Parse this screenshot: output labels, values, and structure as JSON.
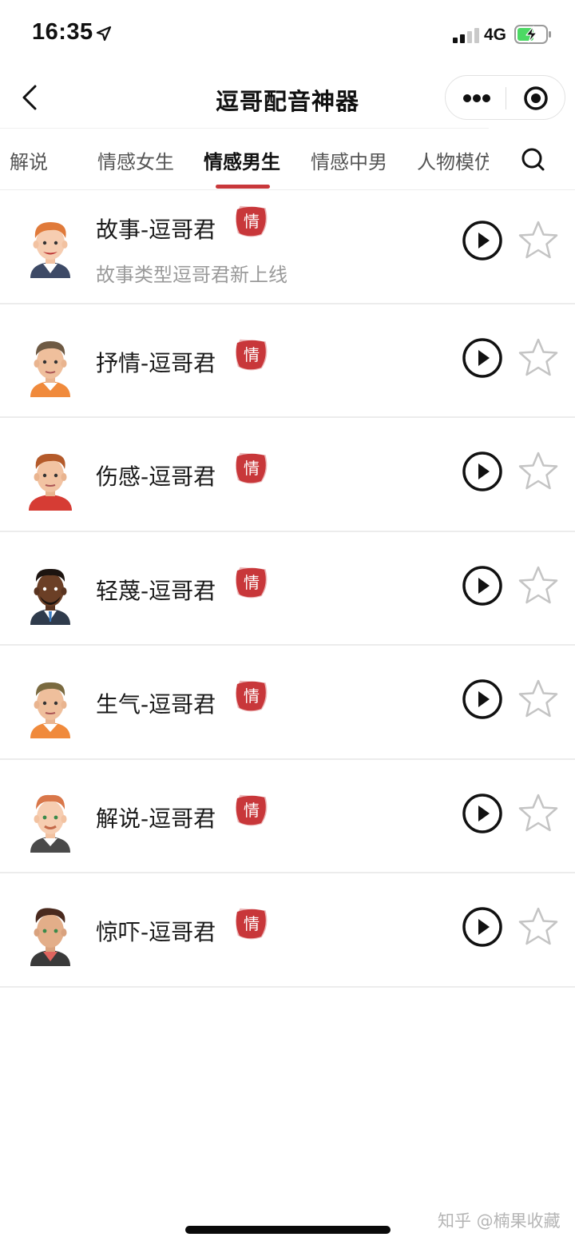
{
  "status_bar": {
    "time": "16:35",
    "network": "4G",
    "icons": [
      "location-arrow-icon",
      "signal-icon",
      "battery-charging-icon"
    ]
  },
  "header": {
    "title": "逗哥配音神器",
    "back_icon": "chevron-left-icon",
    "more_icon": "more-dots-icon",
    "close_icon": "target-circle-icon"
  },
  "tabs": {
    "items": [
      {
        "label": "解说",
        "active": false
      },
      {
        "label": "情感女生",
        "active": false
      },
      {
        "label": "情感男生",
        "active": true
      },
      {
        "label": "情感中男",
        "active": false
      },
      {
        "label": "人物模仿",
        "active": false
      }
    ],
    "search_icon": "search-icon"
  },
  "list": {
    "items": [
      {
        "name": "故事-逗哥君",
        "badge": "情",
        "description": "故事类型逗哥君新上线"
      },
      {
        "name": "抒情-逗哥君",
        "badge": "情"
      },
      {
        "name": "伤感-逗哥君",
        "badge": "情"
      },
      {
        "name": "轻蔑-逗哥君",
        "badge": "情"
      },
      {
        "name": "生气-逗哥君",
        "badge": "情"
      },
      {
        "name": "解说-逗哥君",
        "badge": "情"
      },
      {
        "name": "惊吓-逗哥君",
        "badge": "情"
      }
    ],
    "play_icon": "play-circle-icon",
    "favorite_icon": "star-outline-icon"
  },
  "watermark": "知乎 @楠果收藏",
  "colors": {
    "accent": "#c8373a",
    "badge": "#c8373a",
    "text_primary": "#1a1a1a",
    "text_secondary": "#9a9a9a",
    "divider": "#ececec"
  }
}
